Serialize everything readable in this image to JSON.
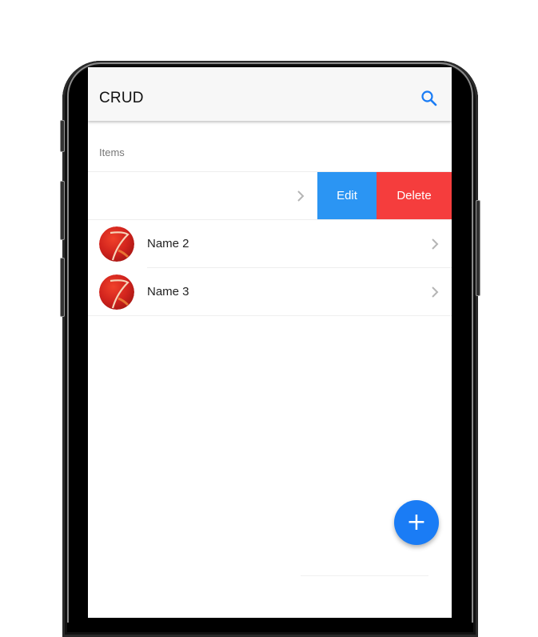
{
  "appbar": {
    "title": "CRUD",
    "search_icon": "search-icon",
    "accent": "#1a7cf5"
  },
  "list": {
    "header": "Items",
    "items": [
      {
        "label": "",
        "swiped": true
      },
      {
        "label": "Name 2"
      },
      {
        "label": "Name 3"
      }
    ]
  },
  "swipe_actions": {
    "edit_label": "Edit",
    "edit_color": "#2b95f3",
    "delete_label": "Delete",
    "delete_color": "#f53d3d"
  },
  "fab": {
    "icon": "plus-icon",
    "label": "+"
  }
}
